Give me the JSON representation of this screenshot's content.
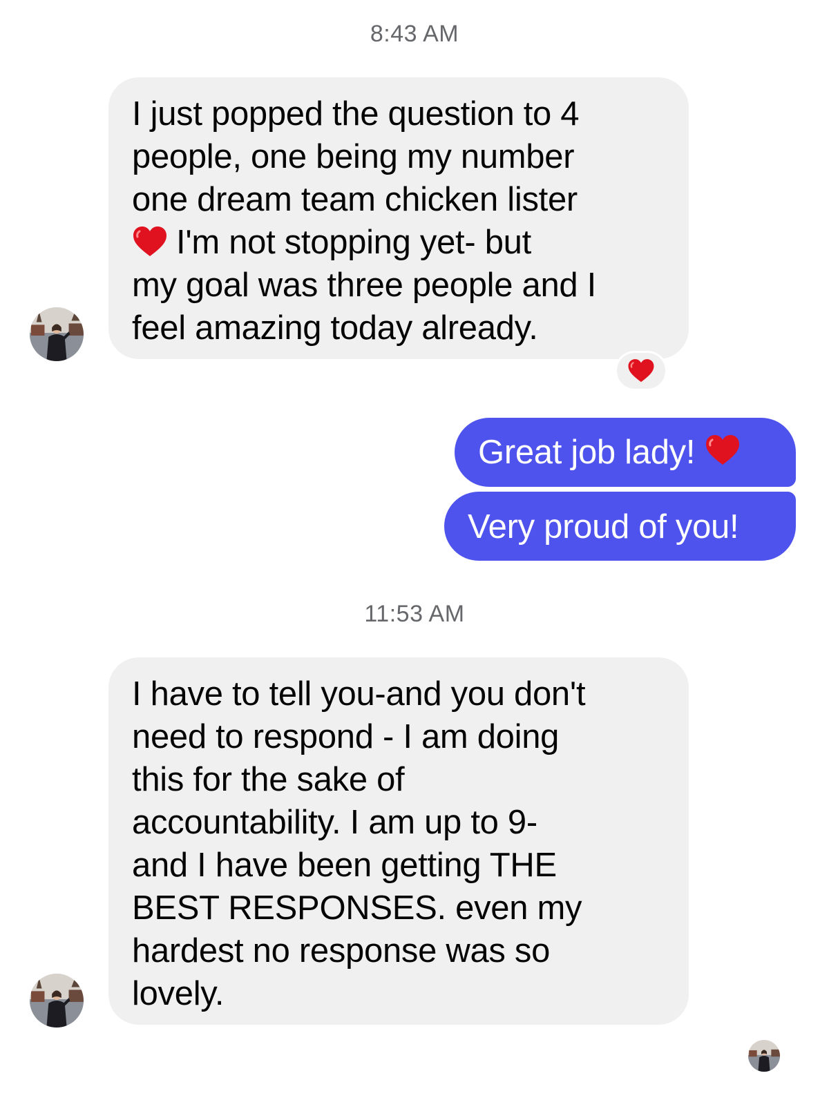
{
  "timestamps": {
    "first": "8:43 AM",
    "second": "11:53 AM"
  },
  "messages": {
    "incoming_1": {
      "lines": [
        "I just popped the question to 4",
        "people, one being my number",
        "one dream team chicken lister",
        "I'm not stopping yet- but",
        "my goal was three people and I",
        "feel amazing today already."
      ],
      "reaction_icon": "red-heart-icon"
    },
    "outgoing_1": {
      "text": "Great job lady!",
      "emoji": "red-heart-icon"
    },
    "outgoing_2": {
      "text": "Very proud of you!"
    },
    "incoming_2": {
      "lines": [
        "I have to tell you-and you don't",
        "need to respond - I am doing",
        "this for the sake of",
        "accountability. I am up to 9-",
        "and I have been getting THE",
        "BEST RESPONSES. even my",
        "hardest no response was so",
        "lovely."
      ]
    }
  },
  "colors": {
    "incoming_bubble": "#f0f0f0",
    "outgoing_bubble": "#4f53ee",
    "timestamp": "#65676b",
    "heart": "#e0121f"
  }
}
